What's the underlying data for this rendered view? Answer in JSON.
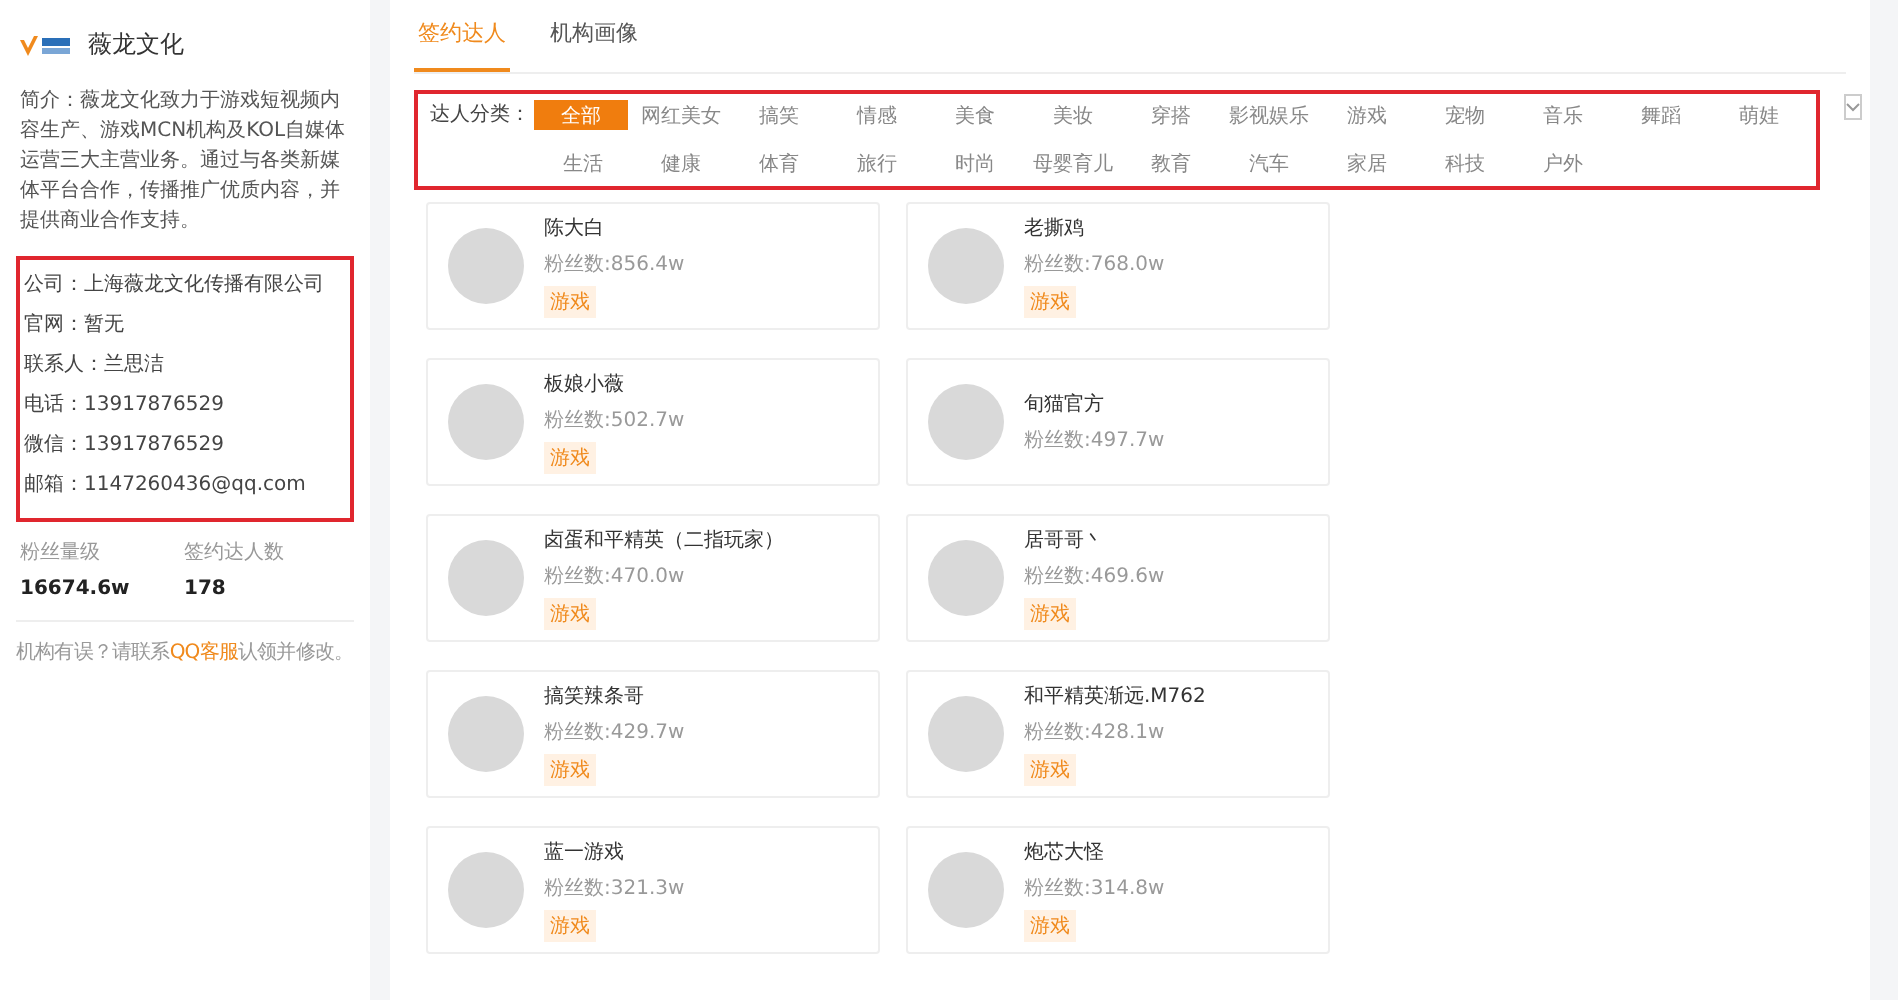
{
  "sidebar": {
    "org_name": "薇龙文化",
    "intro": "简介：薇龙文化致力于游戏短视频内容生产、游戏MCN机构及KOL自媒体运营三大主营业务。通过与各类新媒体平台合作，传播推广优质内容，并提供商业合作支持。",
    "contacts": [
      {
        "label": "公司：",
        "value": "上海薇龙文化传播有限公司"
      },
      {
        "label": "官网：",
        "value": "暂无"
      },
      {
        "label": "联系人：",
        "value": "兰思洁"
      },
      {
        "label": "电话：",
        "value": "13917876529"
      },
      {
        "label": "微信：",
        "value": "13917876529"
      },
      {
        "label": "邮箱：",
        "value": "1147260436@qq.com"
      }
    ],
    "stats": [
      {
        "label": "粉丝量级",
        "value": "16674.6w"
      },
      {
        "label": "签约达人数",
        "value": "178"
      }
    ],
    "note": "机构有误？请联系**QQ客服**认领并修改。"
  },
  "tabs": [
    {
      "label": "签约达人",
      "selected": true
    },
    {
      "label": "机构画像",
      "selected": false
    }
  ],
  "filter": {
    "label": "达人分类：",
    "categories": [
      {
        "label": "全部",
        "selected": true
      },
      {
        "label": "网红美女",
        "selected": false
      },
      {
        "label": "搞笑",
        "selected": false
      },
      {
        "label": "情感",
        "selected": false
      },
      {
        "label": "美食",
        "selected": false
      },
      {
        "label": "美妆",
        "selected": false
      },
      {
        "label": "穿搭",
        "selected": false
      },
      {
        "label": "影视娱乐",
        "selected": false
      },
      {
        "label": "游戏",
        "selected": false
      },
      {
        "label": "宠物",
        "selected": false
      },
      {
        "label": "音乐",
        "selected": false
      },
      {
        "label": "舞蹈",
        "selected": false
      },
      {
        "label": "萌娃",
        "selected": false
      },
      {
        "label": "生活",
        "selected": false
      },
      {
        "label": "健康",
        "selected": false
      },
      {
        "label": "体育",
        "selected": false
      },
      {
        "label": "旅行",
        "selected": false
      },
      {
        "label": "时尚",
        "selected": false
      },
      {
        "label": "母婴育儿",
        "selected": false
      },
      {
        "label": "教育",
        "selected": false
      },
      {
        "label": "汽车",
        "selected": false
      },
      {
        "label": "家居",
        "selected": false
      },
      {
        "label": "科技",
        "selected": false
      },
      {
        "label": "户外",
        "selected": false
      }
    ]
  },
  "influencers": [
    {
      "name": "陈大白",
      "fans": "粉丝数:856.4w",
      "tags": [
        "游戏"
      ]
    },
    {
      "name": "老撕鸡",
      "fans": "粉丝数:768.0w",
      "tags": [
        "游戏"
      ]
    },
    {
      "name": "板娘小薇",
      "fans": "粉丝数:502.7w",
      "tags": [
        "游戏"
      ]
    },
    {
      "name": "旬猫官方",
      "fans": "粉丝数:497.7w"
    },
    {
      "name": "卤蛋和平精英（二指玩家）",
      "fans": "粉丝数:470.0w",
      "tags": [
        "游戏"
      ]
    },
    {
      "name": "居哥哥丶",
      "fans": "粉丝数:469.6w",
      "tags": [
        "游戏"
      ]
    },
    {
      "name": "搞笑辣条哥",
      "fans": "粉丝数:429.7w",
      "tags": [
        "游戏"
      ]
    },
    {
      "name": "和平精英渐远.M762",
      "fans": "粉丝数:428.1w",
      "tags": [
        "游戏"
      ]
    },
    {
      "name": "蓝一游戏",
      "fans": "粉丝数:321.3w",
      "tags": [
        "游戏"
      ]
    },
    {
      "name": "炮芯大怪",
      "fans": "粉丝数:314.8w",
      "tags": [
        "游戏"
      ]
    }
  ]
}
